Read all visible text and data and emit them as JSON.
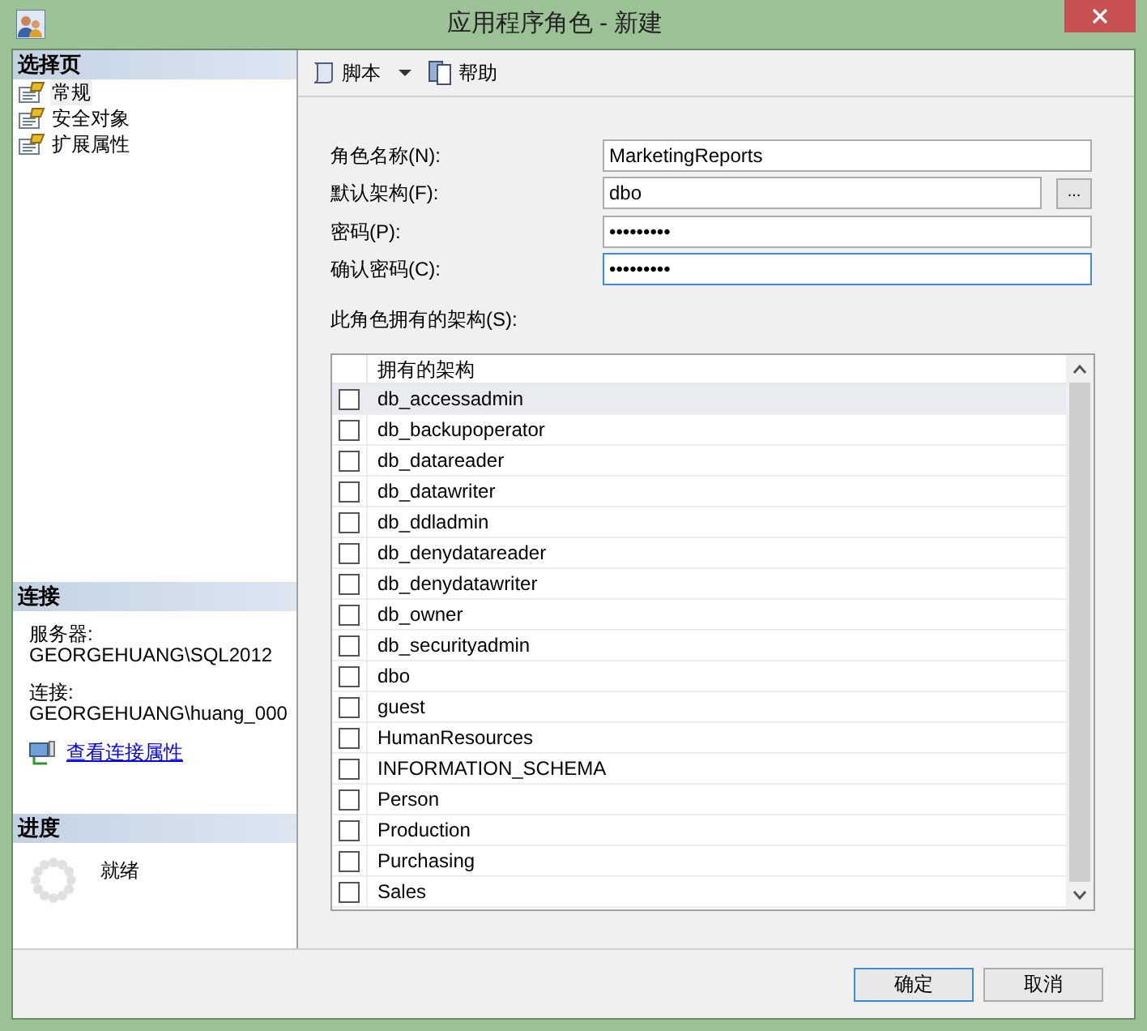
{
  "window": {
    "title": "应用程序角色 - 新建"
  },
  "sidebar": {
    "header": "选择页",
    "items": [
      {
        "label": "常规",
        "selected": true
      },
      {
        "label": "安全对象",
        "selected": false
      },
      {
        "label": "扩展属性",
        "selected": false
      }
    ]
  },
  "connection": {
    "header": "连接",
    "server_label": "服务器:",
    "server": "GEORGEHUANG\\SQL2012",
    "conn_label": "连接:",
    "conn": "GEORGEHUANG\\huang_000",
    "link": "查看连接属性"
  },
  "progress": {
    "header": "进度",
    "status": "就绪"
  },
  "toolbar": [
    {
      "label": "脚本",
      "kind": "dropdown"
    },
    {
      "label": "帮助",
      "kind": "plain"
    }
  ],
  "form": [
    {
      "label": "角色名称(N):",
      "value": "MarketingReports",
      "kind": "text",
      "focused": false
    },
    {
      "label": "默认架构(F):",
      "value": "dbo",
      "kind": "browse",
      "focused": false,
      "button": "..."
    },
    {
      "label": "密码(P):",
      "value": "•••••••••",
      "kind": "text",
      "focused": false
    },
    {
      "label": "确认密码(C):",
      "value": "•••••••••",
      "kind": "text",
      "focused": true
    }
  ],
  "schemas": {
    "label": "此角色拥有的架构(S):",
    "column": "拥有的架构",
    "rows": [
      {
        "name": "db_accessadmin",
        "checked": false,
        "selected": true
      },
      {
        "name": "db_backupoperator",
        "checked": false,
        "selected": false
      },
      {
        "name": "db_datareader",
        "checked": false,
        "selected": false
      },
      {
        "name": "db_datawriter",
        "checked": false,
        "selected": false
      },
      {
        "name": "db_ddladmin",
        "checked": false,
        "selected": false
      },
      {
        "name": "db_denydatareader",
        "checked": false,
        "selected": false
      },
      {
        "name": "db_denydatawriter",
        "checked": false,
        "selected": false
      },
      {
        "name": "db_owner",
        "checked": false,
        "selected": false
      },
      {
        "name": "db_securityadmin",
        "checked": false,
        "selected": false
      },
      {
        "name": "dbo",
        "checked": false,
        "selected": false
      },
      {
        "name": "guest",
        "checked": false,
        "selected": false
      },
      {
        "name": "HumanResources",
        "checked": false,
        "selected": false
      },
      {
        "name": "INFORMATION_SCHEMA",
        "checked": false,
        "selected": false
      },
      {
        "name": "Person",
        "checked": false,
        "selected": false
      },
      {
        "name": "Production",
        "checked": false,
        "selected": false
      },
      {
        "name": "Purchasing",
        "checked": false,
        "selected": false
      },
      {
        "name": "Sales",
        "checked": false,
        "selected": false
      }
    ]
  },
  "buttons": [
    {
      "label": "确定",
      "default": true
    },
    {
      "label": "取消",
      "default": false
    }
  ]
}
